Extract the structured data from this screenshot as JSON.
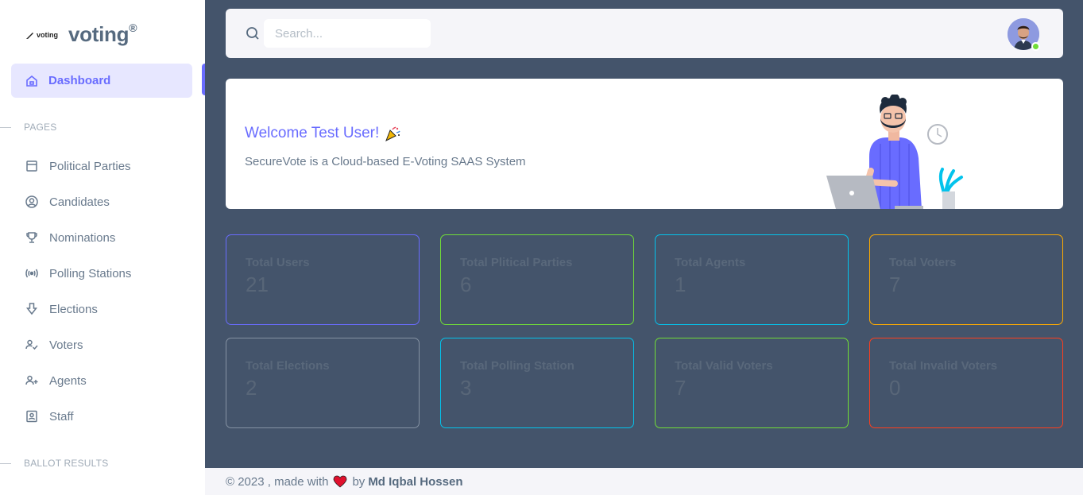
{
  "brand": {
    "logo_text": "voting",
    "name": "voting",
    "mark": "®"
  },
  "nav": {
    "active": {
      "label": "Dashboard",
      "icon": "home-icon"
    },
    "sections": [
      {
        "title": "PAGES"
      },
      {
        "title": "BALLOT RESULTS"
      }
    ],
    "items": [
      {
        "label": "Political Parties",
        "icon": "window-icon"
      },
      {
        "label": "Candidates",
        "icon": "user-circle-icon"
      },
      {
        "label": "Nominations",
        "icon": "trophy-icon"
      },
      {
        "label": "Polling Stations",
        "icon": "broadcast-icon"
      },
      {
        "label": "Elections",
        "icon": "arrow-down-icon"
      },
      {
        "label": "Voters",
        "icon": "user-check-icon"
      },
      {
        "label": "Agents",
        "icon": "user-plus-icon"
      },
      {
        "label": "Staff",
        "icon": "user-badge-icon"
      }
    ]
  },
  "search": {
    "placeholder": "Search..."
  },
  "welcome": {
    "title": "Welcome Test User!",
    "subtitle": "SecureVote is a Cloud-based E-Voting SAAS System"
  },
  "stats": [
    {
      "label": "Total Users",
      "value": "21",
      "color": "#696cff"
    },
    {
      "label": "Total Plitical Parties",
      "value": "6",
      "color": "#71dd37"
    },
    {
      "label": "Total Agents",
      "value": "1",
      "color": "#03c3ec"
    },
    {
      "label": "Total Voters",
      "value": "7",
      "color": "#ffab00"
    },
    {
      "label": "Total Elections",
      "value": "2",
      "color": "#8592a3"
    },
    {
      "label": "Total Polling Station",
      "value": "3",
      "color": "#03c3ec"
    },
    {
      "label": "Total Valid Voters",
      "value": "7",
      "color": "#71dd37"
    },
    {
      "label": "Total Invalid Voters",
      "value": "0",
      "color": "#ff3e1d"
    }
  ],
  "footer": {
    "prefix": "© 2023 , made with",
    "by": "by",
    "author": "Md Iqbal Hossen"
  },
  "colors": {
    "primary": "#696cff",
    "sidebar_bg": "#ffffff",
    "content_bg": "#44546b"
  }
}
